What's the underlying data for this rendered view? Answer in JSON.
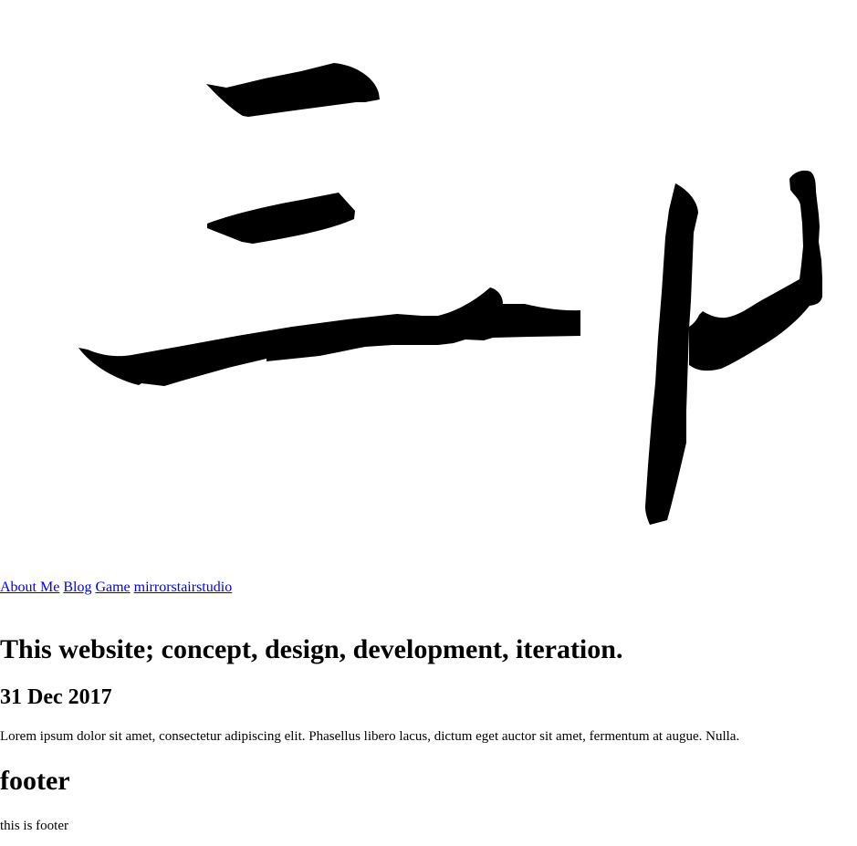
{
  "header": {
    "logo_icon": "calligraphy-logo-icon"
  },
  "nav": {
    "items": [
      {
        "label": "About Me"
      },
      {
        "label": "Blog"
      },
      {
        "label": "Game"
      },
      {
        "label": "mirrorstairstudio"
      }
    ]
  },
  "post": {
    "title": "This website; concept, design, development, iteration.",
    "date": "31 Dec 2017",
    "body": "Lorem ipsum dolor sit amet, consectetur adipiscing elit. Phasellus libero lacus, dictum eget auctor sit amet, fermentum at augue. Nulla."
  },
  "footer": {
    "heading": "footer",
    "text": "this is footer"
  },
  "colors": {
    "link": "#0000ee",
    "text": "#000000",
    "background": "#ffffff"
  }
}
